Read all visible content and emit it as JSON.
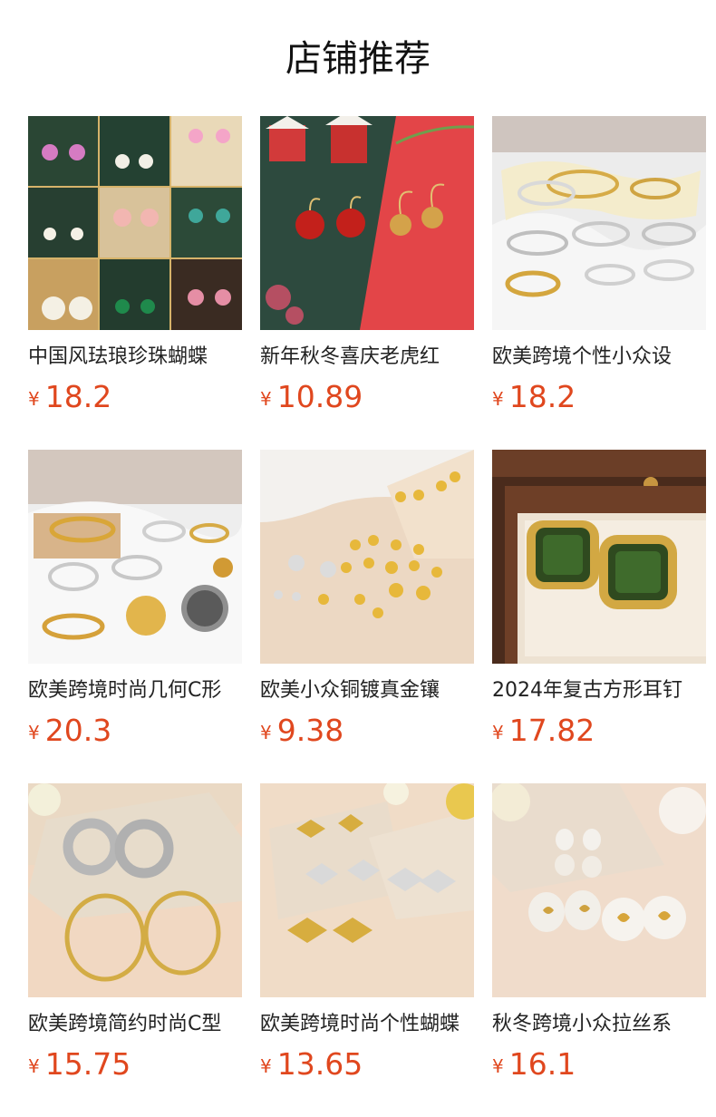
{
  "section_title": "店铺推荐",
  "currency_symbol": "¥",
  "products": [
    {
      "name": "中国风珐琅珍珠蝴蝶",
      "price": "18.2",
      "image": "enamel-pearl-butterfly-earrings-collage"
    },
    {
      "name": "新年秋冬喜庆老虎红",
      "price": "10.89",
      "image": "red-tiger-earrings-on-red-green-backdrop"
    },
    {
      "name": "欧美跨境个性小众设",
      "price": "18.2",
      "image": "gold-silver-bangles-on-white-cloth"
    },
    {
      "name": "欧美跨境时尚几何C形",
      "price": "20.3",
      "image": "geometric-c-shape-cuffs-and-rings"
    },
    {
      "name": "欧美小众铜镀真金镶",
      "price": "9.38",
      "image": "gold-plated-stud-earrings-set"
    },
    {
      "name": "2024年复古方形耳钉",
      "price": "17.82",
      "image": "green-square-stone-earrings-in-wood-box"
    },
    {
      "name": "欧美跨境简约时尚C型",
      "price": "15.75",
      "image": "silver-and-gold-hoop-earrings"
    },
    {
      "name": "欧美跨境时尚个性蝴蝶",
      "price": "13.65",
      "image": "bow-shaped-earrings-gold-silver"
    },
    {
      "name": "秋冬跨境小众拉丝系",
      "price": "16.1",
      "image": "pearl-heart-stud-earrings"
    }
  ]
}
